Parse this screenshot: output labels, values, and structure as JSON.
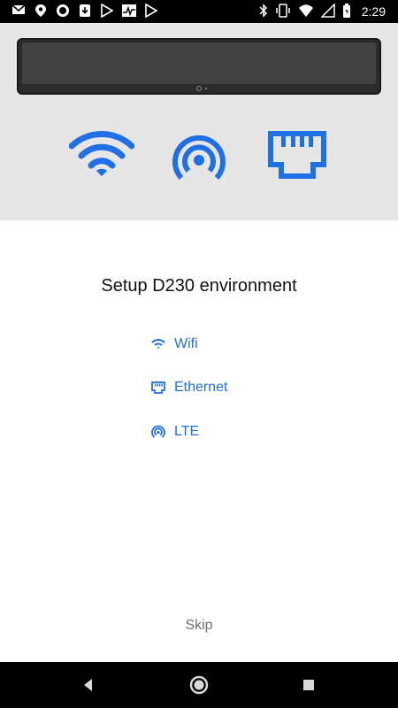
{
  "status_bar": {
    "time": "2:29",
    "left_icons": [
      "gmail-icon",
      "location-icon",
      "circle-icon",
      "download-icon",
      "play-store-icon",
      "activity-icon",
      "play-store-icon"
    ],
    "right_icons": [
      "bluetooth-icon",
      "vibrate-icon",
      "wifi-icon",
      "signal-icon",
      "battery-icon"
    ]
  },
  "hero": {
    "icons": [
      "wifi-icon",
      "lte-icon",
      "ethernet-icon"
    ]
  },
  "main": {
    "title": "Setup D230 environment",
    "options": [
      {
        "label": "Wifi",
        "icon": "wifi-icon"
      },
      {
        "label": "Ethernet",
        "icon": "ethernet-icon"
      },
      {
        "label": "LTE",
        "icon": "lte-icon"
      }
    ],
    "skip_label": "Skip"
  },
  "colors": {
    "accent": "#1f6fe5",
    "hero_background": "#e6e6e6",
    "text_primary": "#111111",
    "text_secondary": "#6e6e6e"
  },
  "nav_bar": {
    "buttons": [
      "back-button",
      "home-button",
      "recents-button"
    ]
  }
}
